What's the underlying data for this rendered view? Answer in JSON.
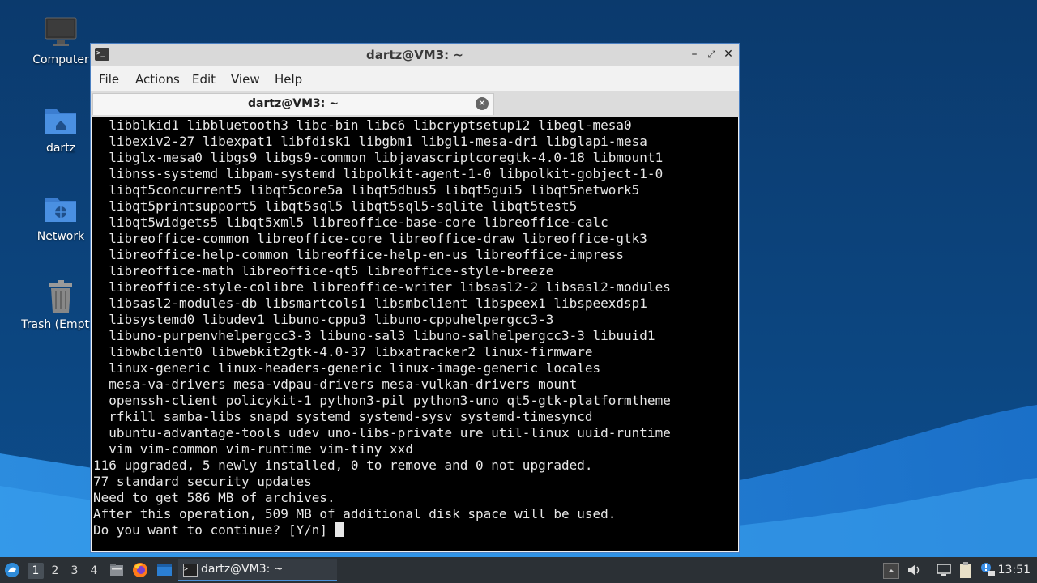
{
  "desktop": {
    "icons": [
      {
        "label": "Computer",
        "icon": "monitor-icon"
      },
      {
        "label": "dartz",
        "icon": "home-folder-icon"
      },
      {
        "label": "Network",
        "icon": "network-folder-icon"
      },
      {
        "label": "Trash (Empty)",
        "icon": "trash-icon"
      }
    ]
  },
  "window": {
    "title": "dartz@VM3: ~",
    "menu": [
      "File",
      "Actions",
      "Edit",
      "View",
      "Help"
    ],
    "tab_label": "dartz@VM3: ~",
    "colors": {
      "titlebar": "#d9d9d9",
      "terminal_bg": "#000000",
      "terminal_fg": "#e8e8e8",
      "border": "#4a7fc1"
    }
  },
  "terminal": {
    "lines": [
      "  libblkid1 libbluetooth3 libc-bin libc6 libcryptsetup12 libegl-mesa0",
      "  libexiv2-27 libexpat1 libfdisk1 libgbm1 libgl1-mesa-dri libglapi-mesa",
      "  libglx-mesa0 libgs9 libgs9-common libjavascriptcoregtk-4.0-18 libmount1",
      "  libnss-systemd libpam-systemd libpolkit-agent-1-0 libpolkit-gobject-1-0",
      "  libqt5concurrent5 libqt5core5a libqt5dbus5 libqt5gui5 libqt5network5",
      "  libqt5printsupport5 libqt5sql5 libqt5sql5-sqlite libqt5test5",
      "  libqt5widgets5 libqt5xml5 libreoffice-base-core libreoffice-calc",
      "  libreoffice-common libreoffice-core libreoffice-draw libreoffice-gtk3",
      "  libreoffice-help-common libreoffice-help-en-us libreoffice-impress",
      "  libreoffice-math libreoffice-qt5 libreoffice-style-breeze",
      "  libreoffice-style-colibre libreoffice-writer libsasl2-2 libsasl2-modules",
      "  libsasl2-modules-db libsmartcols1 libsmbclient libspeex1 libspeexdsp1",
      "  libsystemd0 libudev1 libuno-cppu3 libuno-cppuhelpergcc3-3",
      "  libuno-purpenvhelpergcc3-3 libuno-sal3 libuno-salhelpergcc3-3 libuuid1",
      "  libwbclient0 libwebkit2gtk-4.0-37 libxatracker2 linux-firmware",
      "  linux-generic linux-headers-generic linux-image-generic locales",
      "  mesa-va-drivers mesa-vdpau-drivers mesa-vulkan-drivers mount",
      "  openssh-client policykit-1 python3-pil python3-uno qt5-gtk-platformtheme",
      "  rfkill samba-libs snapd systemd systemd-sysv systemd-timesyncd",
      "  ubuntu-advantage-tools udev uno-libs-private ure util-linux uuid-runtime",
      "  vim vim-common vim-runtime vim-tiny xxd",
      "116 upgraded, 5 newly installed, 0 to remove and 0 not upgraded.",
      "77 standard security updates",
      "Need to get 586 MB of archives.",
      "After this operation, 509 MB of additional disk space will be used."
    ],
    "prompt": "Do you want to continue? [Y/n] "
  },
  "taskbar": {
    "workspaces": [
      "1",
      "2",
      "3",
      "4"
    ],
    "active_workspace": "1",
    "task_label": "dartz@VM3: ~",
    "clock": "13:51",
    "launchers": [
      "file-manager-icon",
      "firefox-icon",
      "desktop-icon"
    ],
    "tray": [
      "tray-arrow-icon",
      "volume-icon",
      "display-icon",
      "clipboard-icon",
      "update-icon"
    ]
  }
}
